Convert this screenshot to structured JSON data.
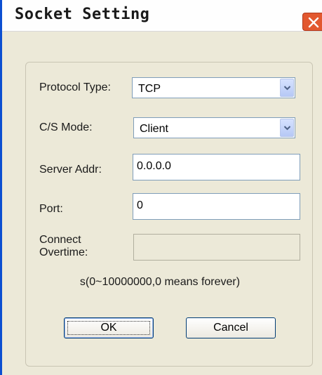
{
  "window": {
    "title": "Socket Setting"
  },
  "form": {
    "protocol_label": "Protocol Type:",
    "protocol_value": "TCP",
    "mode_label": "C/S Mode:",
    "mode_value": "Client",
    "server_label": "Server Addr:",
    "server_value": "0.0.0.0",
    "port_label": "Port:",
    "port_value": "0",
    "overtime_label_line1": "Connect",
    "overtime_label_line2": "Overtime:",
    "overtime_value": "",
    "hint": "s(0~10000000,0 means forever)"
  },
  "buttons": {
    "ok": "OK",
    "cancel": "Cancel"
  },
  "colors": {
    "title_bar_accent": "#0c4fd1",
    "close_button": "#e2582f",
    "dialog_bg": "#ece9d8"
  },
  "icons": {
    "close": "close-icon",
    "dropdown": "chevron-down-icon"
  }
}
